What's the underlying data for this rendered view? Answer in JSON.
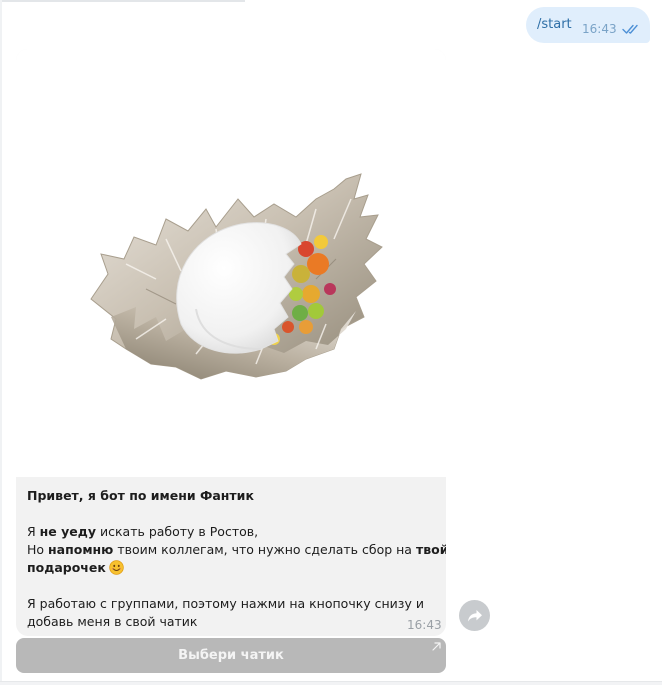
{
  "outgoing": {
    "text": "/start",
    "time": "16:43",
    "status_icon": "double-check-icon"
  },
  "incoming": {
    "image": "candy-wrapper-with-jelly-beans-photo",
    "title": "Привет, я бот по имени Фантик",
    "line1": {
      "a": "Я ",
      "b": "не уеду",
      "c": " искать работу в Ростов,"
    },
    "line2": {
      "a": "Но ",
      "b": "напомню",
      "c": " твоим коллегам, что нужно сделать сбор на ",
      "d": "твой"
    },
    "line3": {
      "b": "подарочек",
      "emoji": "smile-emoji-icon"
    },
    "line4": "Я работаю с группами, поэтому нажми на кнопочку снизу и",
    "line5": "добавь меня в свой чатик",
    "time": "16:43"
  },
  "keyboard": {
    "button_label": "Выбери чатик",
    "button_icon": "external-arrow-icon"
  },
  "forward": {
    "icon": "share-arrow-icon"
  },
  "colors": {
    "outgoing_bubble": "#e0eefc",
    "incoming_bubble": "#f2f2f2",
    "keyboard_button": "#b8b8b8"
  }
}
